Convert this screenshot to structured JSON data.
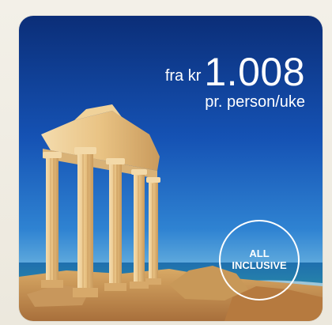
{
  "offer": {
    "price_prefix": "fra kr",
    "price_amount": "1.008",
    "price_unit": "pr. person/uke"
  },
  "badge": {
    "line1": "ALL",
    "line2": "INCLUSIVE"
  },
  "colors": {
    "sky_top": "#0b2e78",
    "sky_bottom": "#6eb6e0",
    "stone": "#e8c58a",
    "text": "#ffffff",
    "background": "#efece3"
  }
}
